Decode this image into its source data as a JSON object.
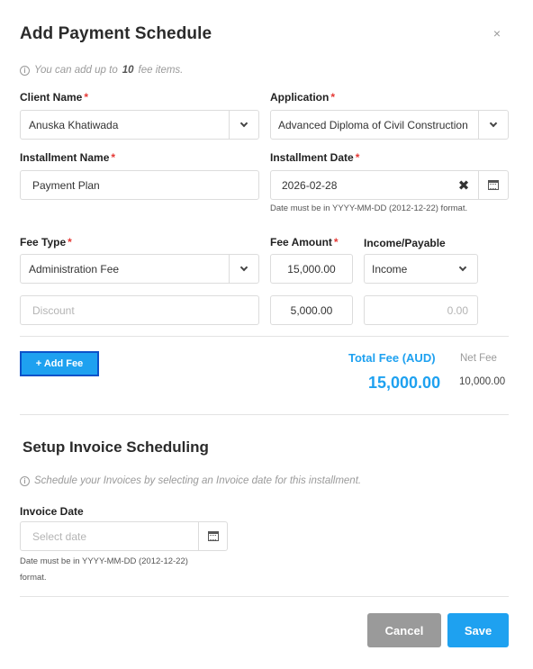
{
  "modal": {
    "title": "Add Payment Schedule",
    "close_icon": "×",
    "info_prefix": "You can add up to",
    "info_count": "10",
    "info_suffix": "fee items."
  },
  "client": {
    "label": "Client Name",
    "value": "Anuska Khatiwada"
  },
  "application": {
    "label": "Application",
    "value": "Advanced Diploma of Civil Construction"
  },
  "installment_name": {
    "label": "Installment Name",
    "value": "Payment Plan"
  },
  "installment_date": {
    "label": "Installment Date",
    "value": "2026-02-28",
    "hint": "Date must be in YYYY-MM-DD (2012-12-22) format."
  },
  "fees": {
    "type_label": "Fee Type",
    "amount_label": "Fee Amount",
    "income_label": "Income/Payable",
    "rows": [
      {
        "type": "Administration Fee",
        "amount": "15,000.00",
        "income": "Income"
      },
      {
        "type": "Discount",
        "amount": "5,000.00",
        "income": "0.00"
      }
    ]
  },
  "add_fee_button": "+ Add Fee",
  "totals": {
    "total_label": "Total Fee (AUD)",
    "total_value": "15,000.00",
    "net_label": "Net Fee",
    "net_value": "10,000.00"
  },
  "invoice": {
    "section_title": "Setup Invoice Scheduling",
    "info": "Schedule your Invoices by selecting an Invoice date for this installment.",
    "date_label": "Invoice Date",
    "date_placeholder": "Select date",
    "hint_line1": "Date must be in YYYY-MM-DD (2012-12-22)",
    "hint_line2": "format."
  },
  "footer": {
    "cancel": "Cancel",
    "save": "Save"
  },
  "icons": {
    "close": "close-icon",
    "info": "info-icon",
    "dropdown": "chevron-down-icon",
    "clear": "clear-icon",
    "calendar": "calendar-icon"
  },
  "colors": {
    "accent": "#1ea1f0",
    "required": "#e53935",
    "cancel": "#9a9a9a",
    "focus_border": "#0b52c9"
  }
}
